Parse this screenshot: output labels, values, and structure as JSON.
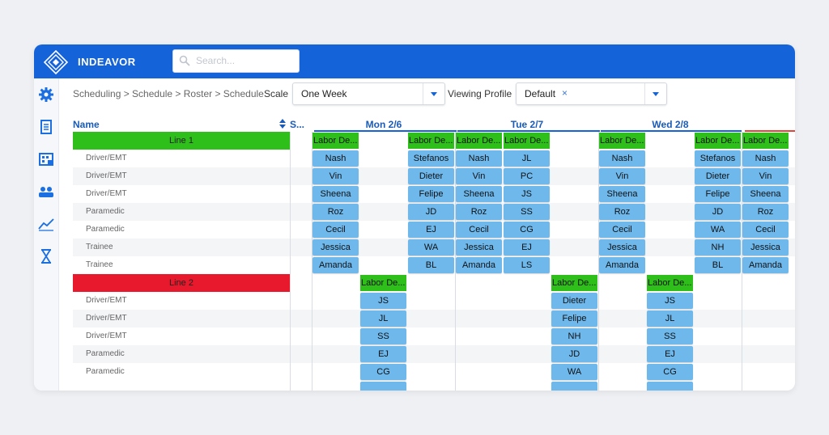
{
  "app": {
    "brand": "INDEAVOR"
  },
  "search": {
    "placeholder": "Search..."
  },
  "sidebar": {
    "icons": [
      "gear-icon",
      "clipboard-icon",
      "calendar-grid-icon",
      "team-icon",
      "chart-icon",
      "hourglass-icon"
    ]
  },
  "breadcrumb": "Scheduling > Schedule > Roster > Schedule",
  "scale": {
    "label": "Scale",
    "value": "One Week"
  },
  "profile": {
    "label": "Viewing Profile",
    "value": "Default",
    "clear": "×"
  },
  "columns": {
    "name": "Name",
    "s": "S...",
    "days": [
      "Mon 2/6",
      "Tue 2/7",
      "Wed 2/8"
    ]
  },
  "lines": [
    {
      "label": "Line 1",
      "color": "#2fbf1a",
      "roles": [
        "Driver/EMT",
        "Driver/EMT",
        "Driver/EMT",
        "Paramedic",
        "Paramedic",
        "Trainee",
        "Trainee"
      ]
    },
    {
      "label": "Line 2",
      "color": "#e8192c",
      "roles": [
        "Driver/EMT",
        "Driver/EMT",
        "Driver/EMT",
        "Paramedic",
        "Paramedic"
      ]
    }
  ],
  "labor_label": "Labor De...",
  "shift_columns": [
    {
      "line": 1,
      "names": [
        "Nash",
        "Vin",
        "Sheena",
        "Roz",
        "Cecil",
        "Jessica",
        "Amanda"
      ]
    },
    {
      "line": 2,
      "names": [
        "JS",
        "JL",
        "SS",
        "EJ",
        "CG"
      ]
    },
    {
      "line": 1,
      "names": [
        "Stefanos",
        "Dieter",
        "Felipe",
        "JD",
        "EJ",
        "WA",
        "BL"
      ]
    },
    {
      "line": 1,
      "names": [
        "Nash",
        "Vin",
        "Sheena",
        "Roz",
        "Cecil",
        "Jessica",
        "Amanda"
      ]
    },
    {
      "line": 1,
      "names": [
        "JL",
        "PC",
        "JS",
        "SS",
        "CG",
        "EJ",
        "LS"
      ]
    },
    {
      "line": 2,
      "names": [
        "Dieter",
        "Felipe",
        "NH",
        "JD",
        "WA"
      ]
    },
    {
      "line": 1,
      "names": [
        "Nash",
        "Vin",
        "Sheena",
        "Roz",
        "Cecil",
        "Jessica",
        "Amanda"
      ]
    },
    {
      "line": 2,
      "names": [
        "JS",
        "JL",
        "SS",
        "EJ",
        "CG"
      ]
    },
    {
      "line": 1,
      "names": [
        "Stefanos",
        "Dieter",
        "Felipe",
        "JD",
        "WA",
        "NH",
        "BL"
      ]
    },
    {
      "line": 1,
      "names": [
        "Nash",
        "Vin",
        "Sheena",
        "Roz",
        "Cecil",
        "Jessica",
        "Amanda"
      ]
    }
  ]
}
